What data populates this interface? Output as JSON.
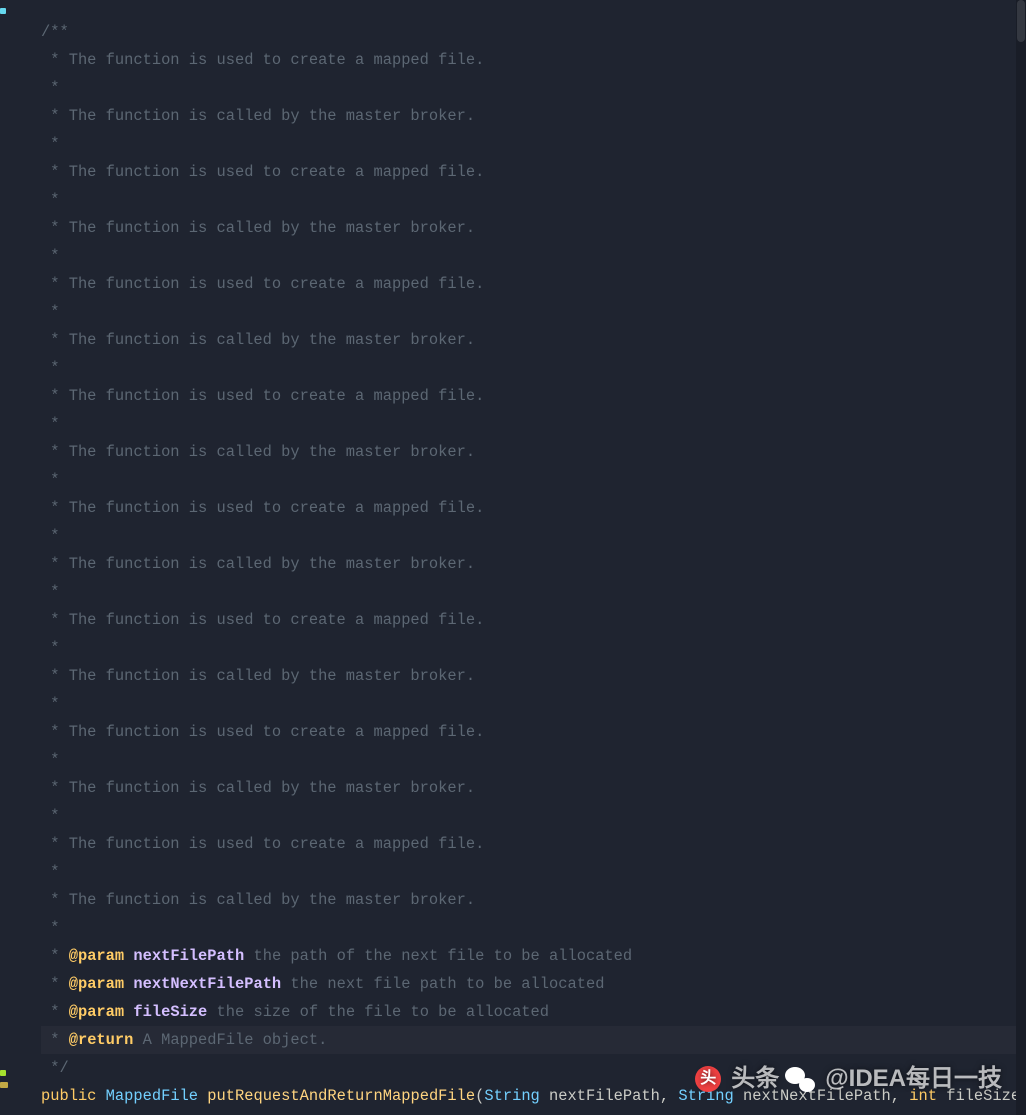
{
  "code": {
    "lines": [
      {
        "kind": "c",
        "text": "/**"
      },
      {
        "kind": "c",
        "text": " * The function is used to create a mapped file."
      },
      {
        "kind": "c",
        "text": " *"
      },
      {
        "kind": "c",
        "text": " * The function is called by the master broker."
      },
      {
        "kind": "c",
        "text": " *"
      },
      {
        "kind": "c",
        "text": " * The function is used to create a mapped file."
      },
      {
        "kind": "c",
        "text": " *"
      },
      {
        "kind": "c",
        "text": " * The function is called by the master broker."
      },
      {
        "kind": "c",
        "text": " *"
      },
      {
        "kind": "c",
        "text": " * The function is used to create a mapped file."
      },
      {
        "kind": "c",
        "text": " *"
      },
      {
        "kind": "c",
        "text": " * The function is called by the master broker."
      },
      {
        "kind": "c",
        "text": " *"
      },
      {
        "kind": "c",
        "text": " * The function is used to create a mapped file."
      },
      {
        "kind": "c",
        "text": " *"
      },
      {
        "kind": "c",
        "text": " * The function is called by the master broker."
      },
      {
        "kind": "c",
        "text": " *"
      },
      {
        "kind": "c",
        "text": " * The function is used to create a mapped file."
      },
      {
        "kind": "c",
        "text": " *"
      },
      {
        "kind": "c",
        "text": " * The function is called by the master broker."
      },
      {
        "kind": "c",
        "text": " *"
      },
      {
        "kind": "c",
        "text": " * The function is used to create a mapped file."
      },
      {
        "kind": "c",
        "text": " *"
      },
      {
        "kind": "c",
        "text": " * The function is called by the master broker."
      },
      {
        "kind": "c",
        "text": " *"
      },
      {
        "kind": "c",
        "text": " * The function is used to create a mapped file."
      },
      {
        "kind": "c",
        "text": " *"
      },
      {
        "kind": "c",
        "text": " * The function is called by the master broker."
      },
      {
        "kind": "c",
        "text": " *"
      },
      {
        "kind": "c",
        "text": " * The function is used to create a mapped file."
      },
      {
        "kind": "c",
        "text": " *"
      },
      {
        "kind": "c",
        "text": " * The function is called by the master broker."
      },
      {
        "kind": "c",
        "text": " *"
      },
      {
        "kind": "p",
        "star": " * ",
        "tag": "@param",
        "name": "nextFilePath",
        "desc": " the path of the next file to be allocated"
      },
      {
        "kind": "p",
        "star": " * ",
        "tag": "@param",
        "name": "nextNextFilePath",
        "desc": " the next file path to be allocated"
      },
      {
        "kind": "p",
        "star": " * ",
        "tag": "@param",
        "name": "fileSize",
        "desc": " the size of the file to be allocated"
      },
      {
        "kind": "r",
        "star": " * ",
        "tag": "@return",
        "desc": " A MappedFile object."
      },
      {
        "kind": "c",
        "text": " */"
      },
      {
        "kind": "sig"
      }
    ],
    "signature": {
      "kw_public": "public",
      "ret_type": "MappedFile",
      "method": "putRequestAndReturnMappedFile",
      "paren_open": "(",
      "p1_type": "String",
      "p1_name": " nextFilePath, ",
      "p2_type": "String",
      "p2_name": " nextNextFilePath, ",
      "p3_kw": "int",
      "p3_name": " fileSize) ",
      "fold": "{...}"
    }
  },
  "watermark": {
    "toutiao_label": "头条",
    "handle": "@IDEA每日一技",
    "toutiao_logo": "头"
  },
  "colors": {
    "bg": "#1f2430",
    "comment": "#5c6773",
    "doc_tag": "#ffcc66",
    "doc_param": "#d4bfff",
    "type": "#73d0ff",
    "method": "#ffd580"
  }
}
